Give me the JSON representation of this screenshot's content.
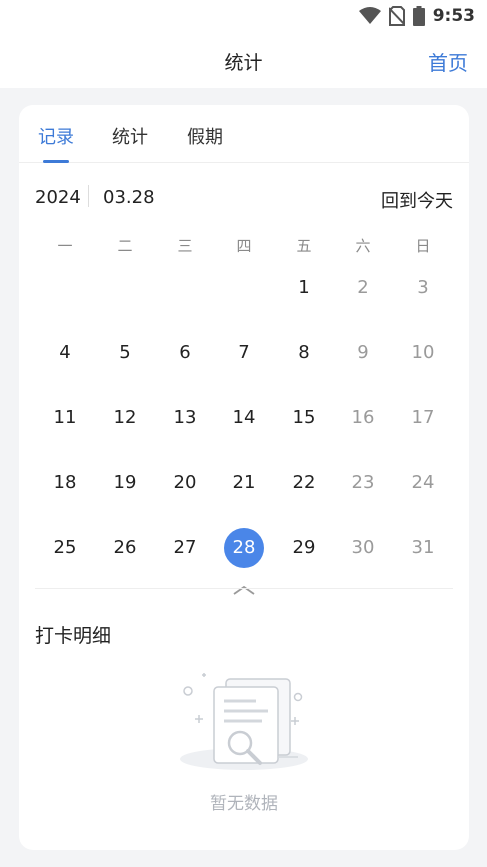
{
  "status": {
    "time": "9:53"
  },
  "nav": {
    "title": "统计",
    "home_label": "首页"
  },
  "tabs": [
    {
      "label": "记录",
      "active": true
    },
    {
      "label": "统计",
      "active": false
    },
    {
      "label": "假期",
      "active": false
    }
  ],
  "calendar": {
    "year": "2024",
    "month_day": "03.28",
    "back_today_label": "回到今天",
    "weekdays": [
      "一",
      "二",
      "三",
      "四",
      "五",
      "六",
      "日"
    ],
    "weeks": [
      [
        "",
        "",
        "",
        "",
        "1",
        "2",
        "3"
      ],
      [
        "4",
        "5",
        "6",
        "7",
        "8",
        "9",
        "10"
      ],
      [
        "11",
        "12",
        "13",
        "14",
        "15",
        "16",
        "17"
      ],
      [
        "18",
        "19",
        "20",
        "21",
        "22",
        "23",
        "24"
      ],
      [
        "25",
        "26",
        "27",
        "28",
        "29",
        "30",
        "31"
      ]
    ],
    "selected_day": "28"
  },
  "detail": {
    "title": "打卡明细",
    "empty_text": "暂无数据"
  },
  "colors": {
    "accent": "#3d7ad7",
    "selected": "#4a86e8",
    "background": "#f3f4f6"
  }
}
